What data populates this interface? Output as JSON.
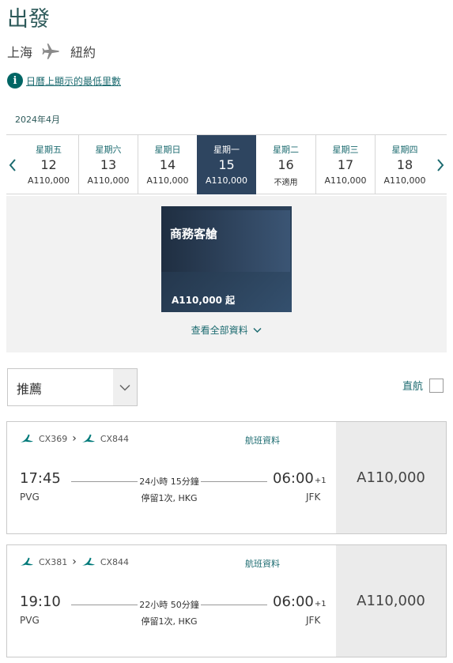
{
  "header": {
    "title": "出發",
    "origin": "上海",
    "destination": "紐約",
    "info_link": "日曆上顯示的最低里數"
  },
  "calendar": {
    "month": "2024年4月",
    "days": [
      {
        "dow": "星期五",
        "day": "12",
        "fare": "A110,000",
        "selected": false
      },
      {
        "dow": "星期六",
        "day": "13",
        "fare": "A110,000",
        "selected": false
      },
      {
        "dow": "星期日",
        "day": "14",
        "fare": "A110,000",
        "selected": false
      },
      {
        "dow": "星期一",
        "day": "15",
        "fare": "A110,000",
        "selected": true
      },
      {
        "dow": "星期二",
        "day": "16",
        "fare": "不適用",
        "selected": false
      },
      {
        "dow": "星期三",
        "day": "17",
        "fare": "A110,000",
        "selected": false
      },
      {
        "dow": "星期四",
        "day": "18",
        "fare": "A110,000",
        "selected": false
      }
    ]
  },
  "cabin": {
    "name": "商務客艙",
    "price": "A110,000 起",
    "see_all": "查看全部資料"
  },
  "filters": {
    "sort_value": "推薦",
    "direct_label": "直航"
  },
  "flights": [
    {
      "flight1": "CX369",
      "flight2": "CX844",
      "info_label": "航班資料",
      "dep_time": "17:45",
      "dep_code": "PVG",
      "duration": "24小時 15分鐘",
      "stops": "停留1次, HKG",
      "arr_time": "06:00",
      "arr_plus": "+1",
      "arr_code": "JFK",
      "price": "A110,000"
    },
    {
      "flight1": "CX381",
      "flight2": "CX844",
      "info_label": "航班資料",
      "dep_time": "19:10",
      "dep_code": "PVG",
      "duration": "22小時 50分鐘",
      "stops": "停留1次, HKG",
      "arr_time": "06:00",
      "arr_plus": "+1",
      "arr_code": "JFK",
      "price": "A110,000"
    }
  ]
}
